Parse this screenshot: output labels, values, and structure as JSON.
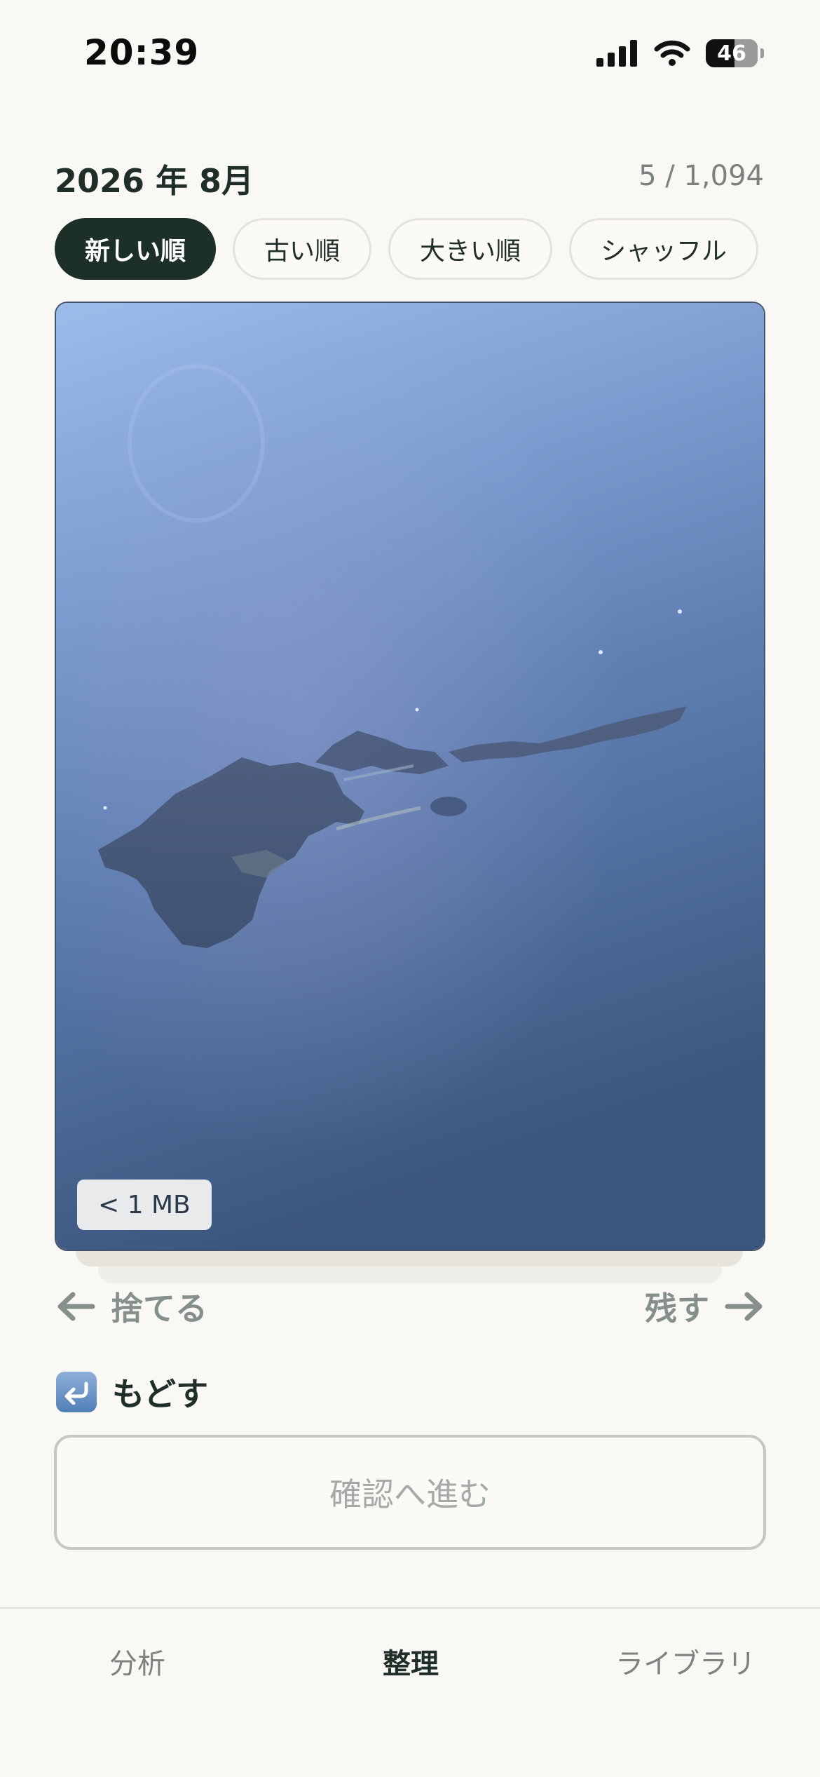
{
  "status_bar": {
    "time": "20:39",
    "battery": "46"
  },
  "header": {
    "month": "2026 年 8月",
    "counter": "5 / 1,094"
  },
  "sort_chips": [
    {
      "label": "新しい順",
      "active": true
    },
    {
      "label": "古い順",
      "active": false
    },
    {
      "label": "大きい順",
      "active": false
    },
    {
      "label": "シャッフル",
      "active": false
    }
  ],
  "photo": {
    "size_label": "< 1 MB"
  },
  "swipe": {
    "discard_label": "捨てる",
    "keep_label": "残す"
  },
  "undo": {
    "label": "もどす"
  },
  "proceed_button": {
    "label": "確認へ進む"
  },
  "tabs": [
    {
      "label": "分析",
      "active": false
    },
    {
      "label": "整理",
      "active": true
    },
    {
      "label": "ライブラリ",
      "active": false
    }
  ],
  "colors": {
    "background": "#f9f8f5",
    "primary": "#1c3027",
    "muted": "#86908a",
    "sky_top": "#9cbcea",
    "sea_bottom": "#3b567e"
  }
}
